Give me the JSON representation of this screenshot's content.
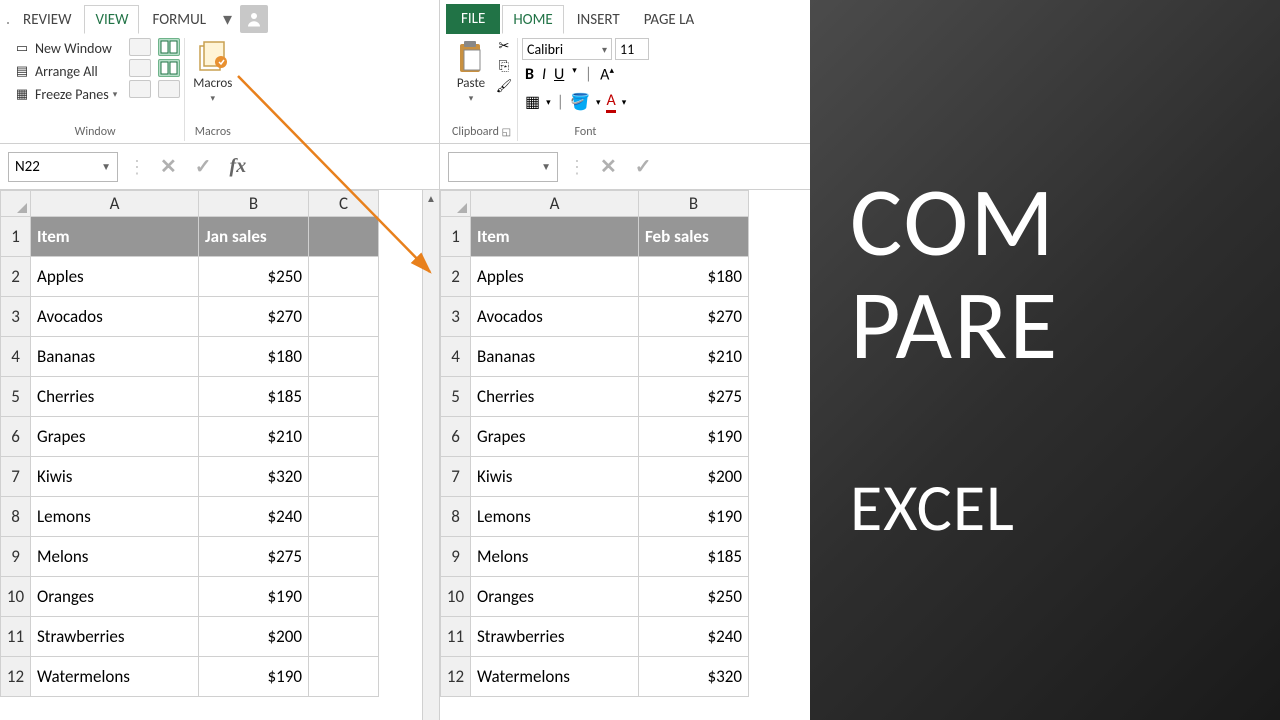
{
  "left": {
    "tabs": [
      "REVIEW",
      "VIEW",
      "FORMUL"
    ],
    "active_tab": "VIEW",
    "ribbon": {
      "window_group_label": "Window",
      "macros_group_label": "Macros",
      "new_window": "New Window",
      "arrange_all": "Arrange All",
      "freeze_panes": "Freeze Panes",
      "macros_label": "Macros"
    },
    "name_box": "N22",
    "headers": {
      "item": "Item",
      "sales": "Jan sales"
    },
    "rows": [
      {
        "n": 1,
        "item": "Item",
        "sales": "Jan sales",
        "hdr": true
      },
      {
        "n": 2,
        "item": "Apples",
        "sales": "$250"
      },
      {
        "n": 3,
        "item": "Avocados",
        "sales": "$270"
      },
      {
        "n": 4,
        "item": "Bananas",
        "sales": "$180"
      },
      {
        "n": 5,
        "item": "Cherries",
        "sales": "$185"
      },
      {
        "n": 6,
        "item": "Grapes",
        "sales": "$210"
      },
      {
        "n": 7,
        "item": "Kiwis",
        "sales": "$320"
      },
      {
        "n": 8,
        "item": "Lemons",
        "sales": "$240"
      },
      {
        "n": 9,
        "item": "Melons",
        "sales": "$275"
      },
      {
        "n": 10,
        "item": "Oranges",
        "sales": "$190"
      },
      {
        "n": 11,
        "item": "Strawberries",
        "sales": "$200"
      },
      {
        "n": 12,
        "item": "Watermelons",
        "sales": "$190"
      }
    ],
    "columns": [
      "A",
      "B",
      "C"
    ]
  },
  "right": {
    "tabs_file": "FILE",
    "tabs": [
      "HOME",
      "INSERT",
      "PAGE LA"
    ],
    "active_tab": "HOME",
    "ribbon": {
      "clipboard_label": "Clipboard",
      "font_label": "Font",
      "paste_label": "Paste",
      "font_name": "Calibri",
      "font_size": "11"
    },
    "name_box": "",
    "headers": {
      "item": "Item",
      "sales": "Feb sales"
    },
    "rows": [
      {
        "n": 1,
        "item": "Item",
        "sales": "Feb sales",
        "hdr": true
      },
      {
        "n": 2,
        "item": "Apples",
        "sales": "$180"
      },
      {
        "n": 3,
        "item": "Avocados",
        "sales": "$270"
      },
      {
        "n": 4,
        "item": "Bananas",
        "sales": "$210"
      },
      {
        "n": 5,
        "item": "Cherries",
        "sales": "$275"
      },
      {
        "n": 6,
        "item": "Grapes",
        "sales": "$190"
      },
      {
        "n": 7,
        "item": "Kiwis",
        "sales": "$200"
      },
      {
        "n": 8,
        "item": "Lemons",
        "sales": "$190"
      },
      {
        "n": 9,
        "item": "Melons",
        "sales": "$185"
      },
      {
        "n": 10,
        "item": "Oranges",
        "sales": "$250"
      },
      {
        "n": 11,
        "item": "Strawberries",
        "sales": "$240"
      },
      {
        "n": 12,
        "item": "Watermelons",
        "sales": "$320"
      }
    ],
    "columns": [
      "A",
      "B"
    ]
  },
  "overlay": {
    "line1": "COM",
    "line2": "PARE",
    "line3": "EXCEL"
  }
}
